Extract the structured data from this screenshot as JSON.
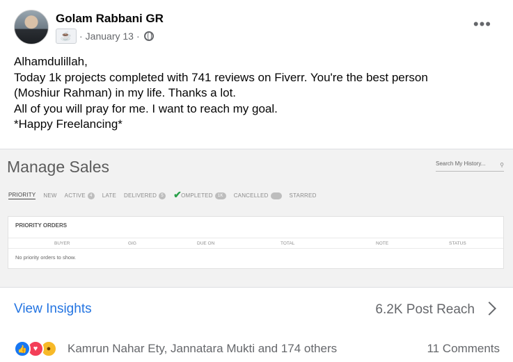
{
  "post": {
    "author": "Golam Rabbani GR",
    "date": "January 13",
    "separator": "·",
    "lines": [
      "Alhamdulillah,",
      "Today 1k projects completed with 741 reviews on Fiverr. You're the best person",
      "(Moshiur Rahman) in my life. Thanks a lot.",
      "All of you will pray for me. I want to reach my goal.",
      "*Happy Freelancing*"
    ]
  },
  "screenshot": {
    "title": "Manage Sales",
    "search_placeholder": "Search My History...",
    "tabs": [
      {
        "label": "PRIORITY",
        "badge": ""
      },
      {
        "label": "NEW",
        "badge": ""
      },
      {
        "label": "ACTIVE",
        "badge": "4"
      },
      {
        "label": "LATE",
        "badge": ""
      },
      {
        "label": "DELIVERED",
        "badge": "5"
      },
      {
        "label": "OMPLETED",
        "badge": "1K"
      },
      {
        "label": "CANCELLED",
        "badge": ""
      },
      {
        "label": "STARRED",
        "badge": ""
      }
    ],
    "panel_title": "PRIORITY ORDERS",
    "columns": [
      "BUYER",
      "GIG",
      "DUE ON",
      "TOTAL",
      "NOTE",
      "STATUS"
    ],
    "empty_message": "No priority orders to show."
  },
  "insights": {
    "link": "View Insights",
    "reach": "6.2K Post Reach"
  },
  "reactions": {
    "names": "Kamrun Nahar Ety, Jannatara Mukti and 174 others",
    "comments": "11 Comments",
    "icons": [
      "like-icon",
      "love-icon",
      "wow-icon"
    ]
  },
  "colors": {
    "link_blue": "#2374e1",
    "like_blue": "#1877f2",
    "love_red": "#f33e58",
    "wow_yellow": "#f7b928",
    "check_green": "#2aa04a"
  }
}
